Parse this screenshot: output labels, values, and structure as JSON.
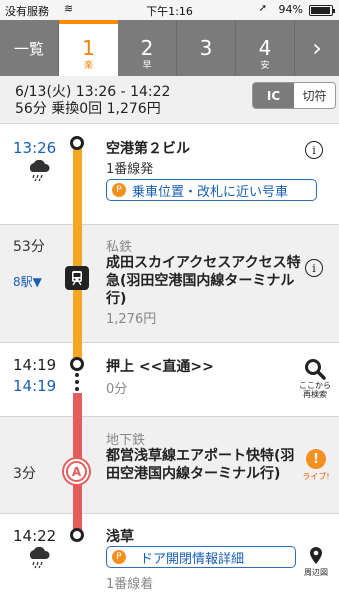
{
  "status_bar": {
    "carrier": "没有服務",
    "time": "下午1:16",
    "battery": "94%",
    "battery_level": 0.94
  },
  "tabs": {
    "list_label": "一覧",
    "routes": [
      {
        "number": "1",
        "tag": "楽",
        "active": true
      },
      {
        "number": "2",
        "tag": "早",
        "active": false
      },
      {
        "number": "3",
        "tag": "",
        "active": false
      },
      {
        "number": "4",
        "tag": "安",
        "active": false
      }
    ],
    "next_label": "›"
  },
  "summary": {
    "line1": "6/13(火) 13:26 - 14:22",
    "line2": "56分 乗換0回 1,276円",
    "fare_options": [
      "IC",
      "切符"
    ]
  },
  "route": {
    "start": {
      "time": "13:26",
      "station": "空港第２ビル",
      "platform": "1番線発",
      "link": "乗車位置・改札に近い号車"
    },
    "leg1": {
      "duration": "53分",
      "stops": "8駅▼",
      "company": "私鉄",
      "train": "成田スカイアクセスアクセス特急(羽田空港国内線ターミナル行)",
      "fare": "1,276円"
    },
    "transfer": {
      "arrive_time": "14:19",
      "depart_time": "14:19",
      "station": "押上 <<直通>>",
      "wait": "0分",
      "search_label": "ここから再検索"
    },
    "leg2": {
      "duration": "3分",
      "company": "地下鉄",
      "train": "都営浅草線エアポート快特(羽田空港国内線ターミナル行)",
      "line_badge": "A",
      "live_label": "ライブ!"
    },
    "end": {
      "time": "14:22",
      "station": "浅草",
      "link": "ドア開閉情報詳細",
      "platform": "1番線着",
      "map_label": "周辺図"
    }
  },
  "colors": {
    "accent": "#ff8c00",
    "line_orange": "#f5a623",
    "line_red": "#e35d5d",
    "link_blue": "#1a5fb4"
  }
}
